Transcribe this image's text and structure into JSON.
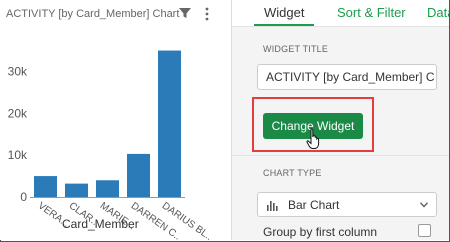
{
  "chart": {
    "title": "ACTIVITY [by Card_Member] Chart",
    "x_label": "Card_Member"
  },
  "chart_data": {
    "type": "bar",
    "categories": [
      "VERA...",
      "CLAR...",
      "MARIE...",
      "DARREN C...",
      "DARIUS BL..."
    ],
    "values": [
      5000,
      3200,
      4000,
      10300,
      35000
    ],
    "xlabel": "Card_Member",
    "ylabel": "",
    "yticks": [
      "0",
      "10k",
      "20k",
      "30k"
    ],
    "ylim": [
      0,
      38000
    ],
    "bar_color": "#2b7bb9"
  },
  "tabs": [
    {
      "label": "Widget"
    },
    {
      "label": "Sort & Filter"
    },
    {
      "label": "Data"
    }
  ],
  "settings": {
    "widget_title_label": "WIDGET TITLE",
    "widget_title_value": "ACTIVITY [by Card_Member] C",
    "change_widget_label": "Change Widget",
    "chart_type_label": "CHART TYPE",
    "chart_type_value": "Bar Chart",
    "group_label": "Group by first column"
  },
  "colors": {
    "accent": "#1a9e4b",
    "button": "#1b8a47",
    "highlight": "#e53c3c"
  },
  "icons": [
    "filter-icon",
    "more-icon",
    "bar-chart-icon",
    "chevron-down-icon",
    "hand-cursor-icon"
  ]
}
